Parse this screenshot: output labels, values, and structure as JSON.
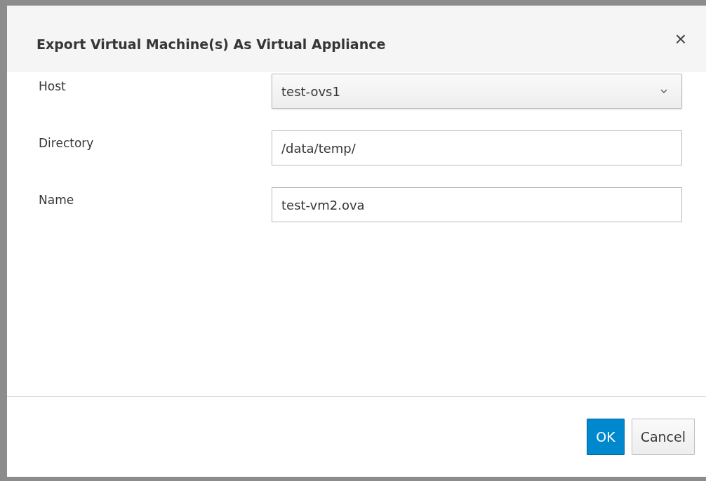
{
  "dialog": {
    "title": "Export Virtual Machine(s) As Virtual Appliance",
    "close": "×"
  },
  "fields": [
    {
      "kind": "select",
      "label": "Host",
      "value": "test-ovs1"
    },
    {
      "kind": "input",
      "label": "Directory",
      "value": "/data/temp/"
    },
    {
      "kind": "input",
      "label": "Name",
      "value": "test-vm2.ova"
    }
  ],
  "buttons": [
    {
      "label": "OK",
      "primary": true
    },
    {
      "label": "Cancel",
      "primary": false
    }
  ]
}
